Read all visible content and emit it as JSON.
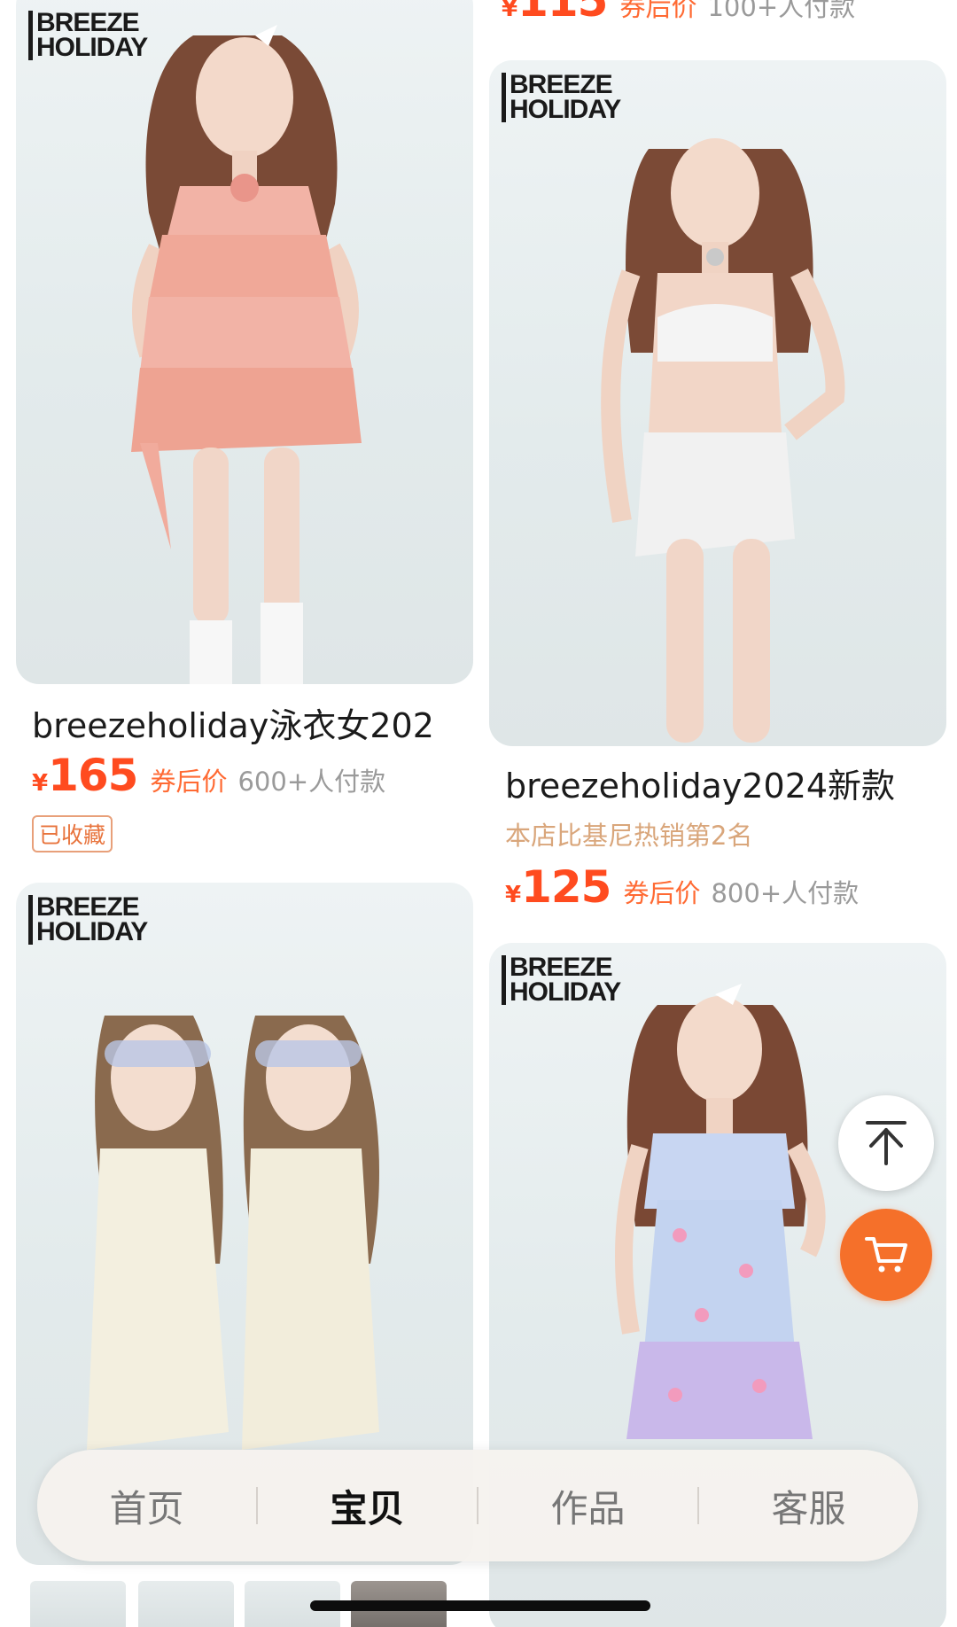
{
  "colors": {
    "accent": "#ff4b1f",
    "coupon": "#ff6a33",
    "cart_button": "#f5702a",
    "rank_text": "#d9a67b"
  },
  "brand_logo": {
    "line1": "BREEZE",
    "line2": "HOLIDAY"
  },
  "partial_top": {
    "price_prefix": "¥",
    "price": "115",
    "coupon_label": "券后价",
    "paid": "100+人付款"
  },
  "products": [
    {
      "title": "breezeholiday泳衣女202",
      "price_prefix": "¥",
      "price": "165",
      "coupon_label": "券后价",
      "paid": "600+人付款",
      "tag": "已收藏"
    },
    {
      "title": "breezeholiday2024新款",
      "rank": "本店比基尼热销第2名",
      "price_prefix": "¥",
      "price": "125",
      "coupon_label": "券后价",
      "paid": "800+人付款"
    }
  ],
  "floating": {
    "scroll_top_icon": "arrow-up-to-top-icon",
    "cart_icon": "shopping-cart-icon"
  },
  "bottom_nav": {
    "items": [
      "首页",
      "宝贝",
      "作品",
      "客服"
    ],
    "active_index": 1
  }
}
